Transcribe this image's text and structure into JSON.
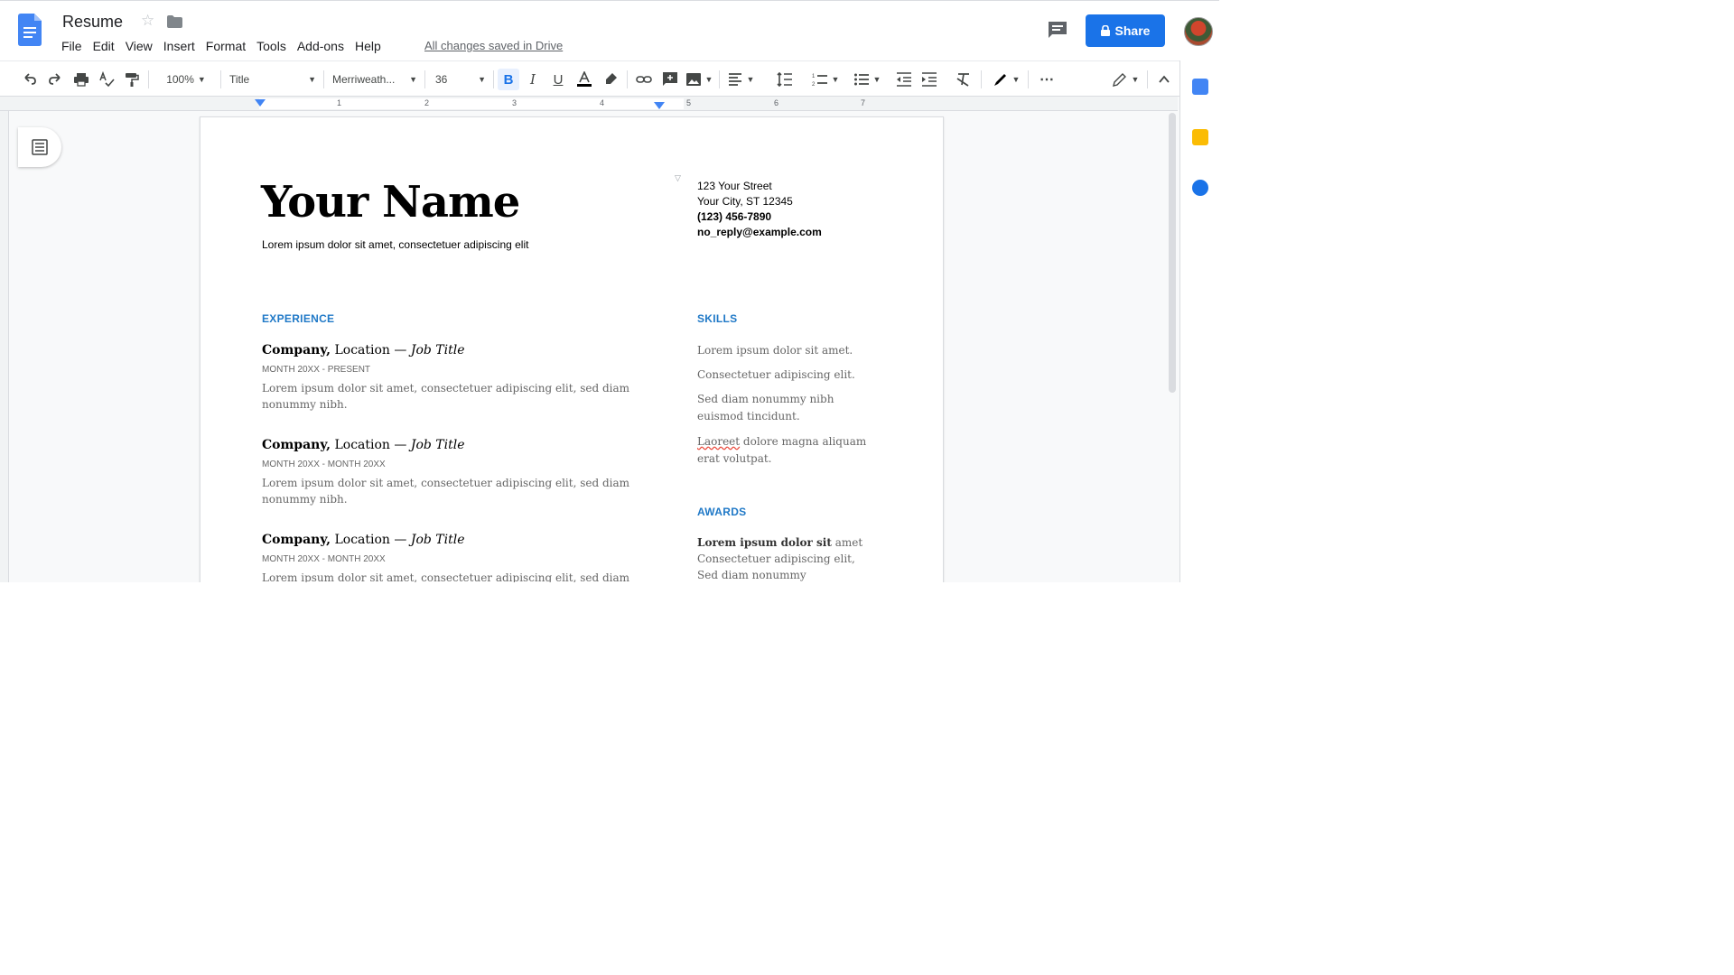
{
  "app": {
    "title": "Resume",
    "save_status": "All changes saved in Drive",
    "share_label": "Share",
    "accent_color": "#1a73e8"
  },
  "menu": [
    "File",
    "Edit",
    "View",
    "Insert",
    "Format",
    "Tools",
    "Add-ons",
    "Help"
  ],
  "toolbar": {
    "zoom": "100%",
    "style": "Title",
    "font": "Merriweath...",
    "font_size": "36",
    "icons": [
      "undo-icon",
      "redo-icon",
      "print-icon",
      "spellcheck-icon",
      "paint-format-icon",
      "bold-icon",
      "italic-icon",
      "underline-icon",
      "text-color-icon",
      "highlight-icon",
      "link-icon",
      "comment-add-icon",
      "image-icon",
      "align-icon",
      "line-spacing-icon",
      "numbered-list-icon",
      "bulleted-list-icon",
      "decrease-indent-icon",
      "increase-indent-icon",
      "clear-formatting-icon",
      "pen-icon",
      "more-icon",
      "editing-mode-icon",
      "collapse-icon"
    ]
  },
  "ruler": {
    "numbers": [
      "1",
      "2",
      "3",
      "4",
      "5",
      "6",
      "7"
    ]
  },
  "document": {
    "name": "Your Name",
    "tagline": "Lorem ipsum dolor sit amet, consectetuer adipiscing elit",
    "contact": {
      "street": "123 Your Street",
      "city": "Your City, ST 12345",
      "phone": "(123) 456-7890",
      "email": "no_reply@example.com"
    },
    "experience_heading": "EXPERIENCE",
    "jobs": [
      {
        "company": "Company,",
        "location": " Location — ",
        "title": "Job Title",
        "dates": "MONTH 20XX - PRESENT",
        "desc": "Lorem ipsum dolor sit amet, consectetuer adipiscing elit, sed diam nonummy nibh."
      },
      {
        "company": "Company,",
        "location": " Location — ",
        "title": "Job Title",
        "dates": "MONTH 20XX - MONTH 20XX",
        "desc": "Lorem ipsum dolor sit amet, consectetuer adipiscing elit, sed diam nonummy nibh."
      },
      {
        "company": "Company,",
        "location": " Location — ",
        "title": "Job Title",
        "dates": "MONTH 20XX - MONTH 20XX",
        "desc": "Lorem ipsum dolor sit amet, consectetuer adipiscing elit, sed diam"
      }
    ],
    "skills_heading": "SKILLS",
    "skills": [
      "Lorem ipsum dolor sit amet.",
      "Consectetuer adipiscing elit.",
      "Sed diam nonummy nibh euismod tincidunt."
    ],
    "skill_last": {
      "misspelled": "Laoreet",
      "rest": " dolore magna aliquam erat volutpat."
    },
    "awards_heading": "AWARDS",
    "award": {
      "bold": "Lorem ipsum dolor sit",
      "rest": " amet Consectetuer adipiscing elit, Sed diam nonummy"
    }
  }
}
